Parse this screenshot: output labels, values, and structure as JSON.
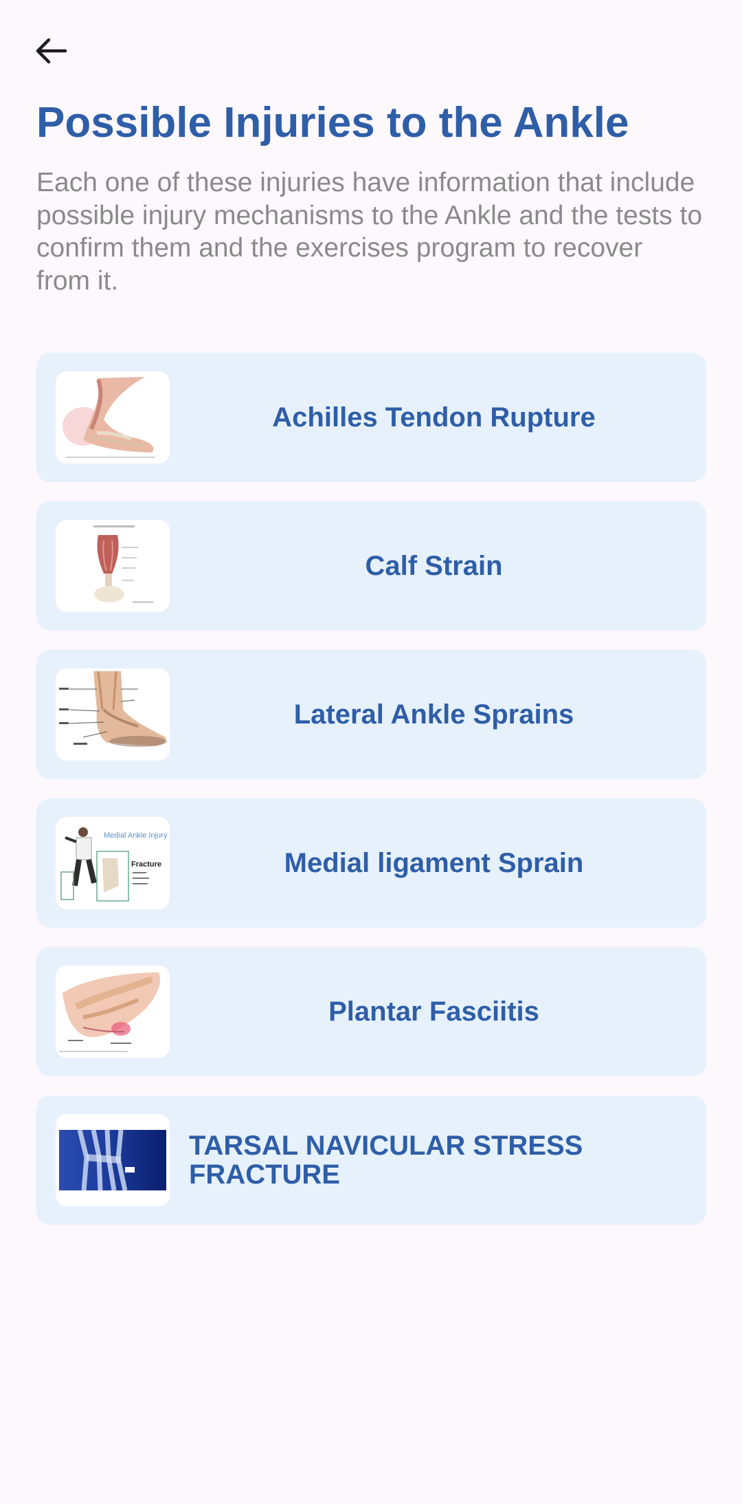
{
  "header": {
    "back_icon": "arrow-left-icon"
  },
  "page": {
    "title": "Possible Injuries to the Ankle",
    "description": "Each one of these injuries have information that include possible injury mechanisms to the Ankle and the tests to confirm them and the exercises program to recover from it."
  },
  "injuries": [
    {
      "title": "Achilles Tendon Rupture",
      "thumbnail": "achilles-tendon-illustration"
    },
    {
      "title": "Calf Strain",
      "thumbnail": "calf-muscle-illustration"
    },
    {
      "title": "Lateral Ankle Sprains",
      "thumbnail": "lateral-ankle-ligaments-illustration"
    },
    {
      "title": "Medial ligament Sprain",
      "thumbnail": "medial-ankle-injury-illustration",
      "thumb_labels": [
        "Medial Ankle Injury",
        "Fracture"
      ]
    },
    {
      "title": "Plantar Fasciitis",
      "thumbnail": "plantar-fascia-illustration"
    },
    {
      "title": "TARSAL NAVICULAR STRESS FRACTURE",
      "thumbnail": "foot-xray-image"
    }
  ],
  "colors": {
    "accent": "#2f5ea8",
    "card_background": "#e6f1fc",
    "page_background": "#fdf8fc",
    "description_text": "#8a8a8a"
  }
}
